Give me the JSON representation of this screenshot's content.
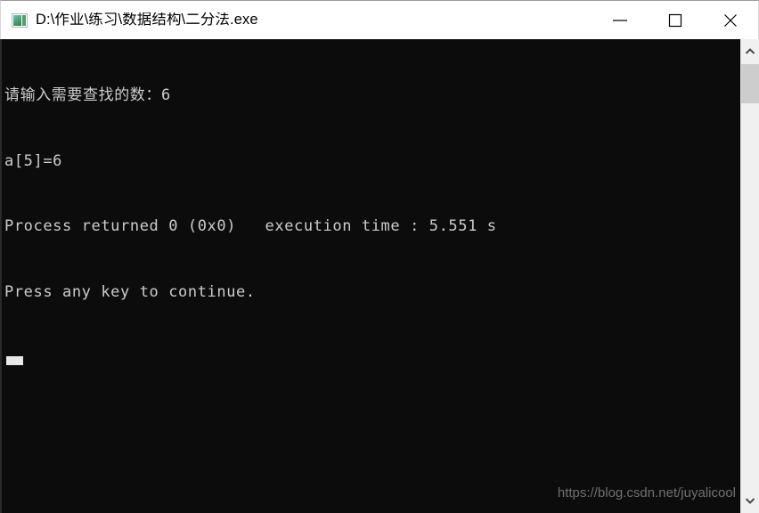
{
  "window": {
    "title": "D:\\作业\\练习\\数据结构\\二分法.exe",
    "icon": "console-app-icon",
    "titlebar_bg": "#ffffff",
    "console_bg": "#0c0c0c",
    "console_fg": "#cccccc"
  },
  "controls": {
    "minimize": {
      "name": "minimize-button",
      "glyph": "minimize-icon"
    },
    "maximize": {
      "name": "maximize-button",
      "glyph": "maximize-icon"
    },
    "close": {
      "name": "close-button",
      "glyph": "close-icon"
    }
  },
  "console": {
    "lines": [
      "请输入需要查找的数：6",
      "a[5]=6",
      "Process returned 0 (0x0)   execution time : 5.551 s",
      "Press any key to continue."
    ],
    "cursor": "block-cursor"
  },
  "watermark": {
    "text": "https://blog.csdn.net/juyalicool",
    "color": "#707070"
  },
  "scrollbar": {
    "up_arrow": "scroll-up-icon",
    "down_arrow": "scroll-down-icon",
    "thumb": "scrollbar-thumb",
    "track_color": "#f0f0f0",
    "thumb_color": "#cdcdcd"
  }
}
